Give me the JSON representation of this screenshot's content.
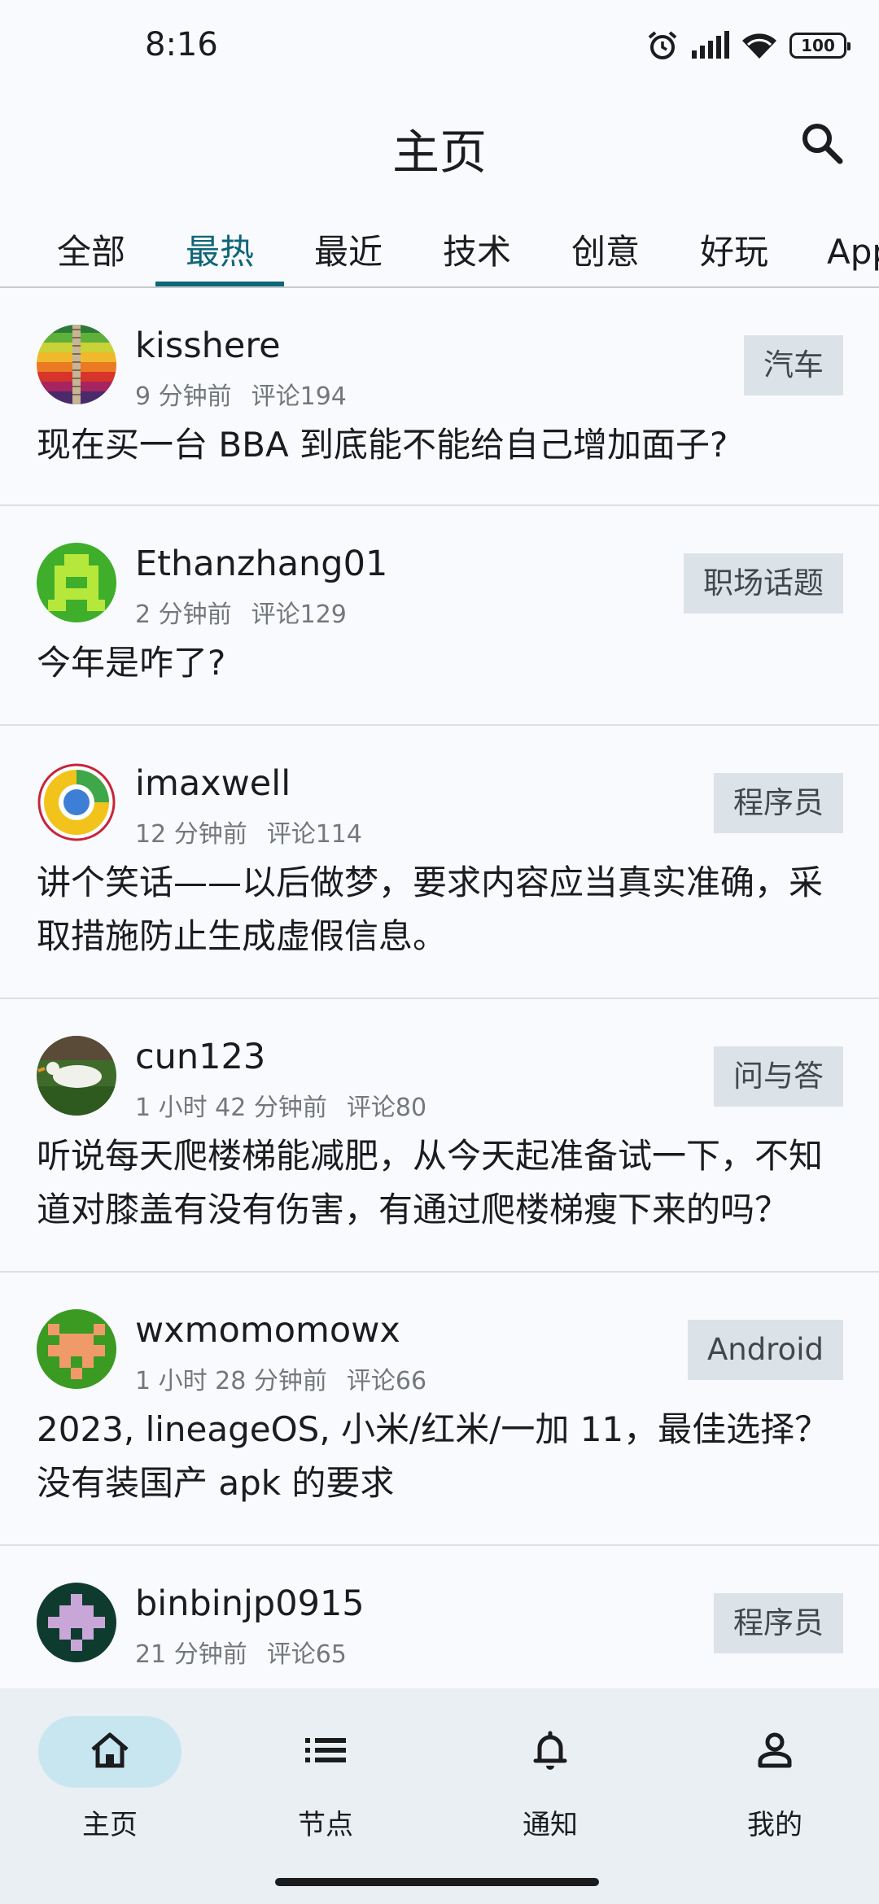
{
  "status_bar": {
    "time": "8:16",
    "battery": "100",
    "icons": [
      "alarm-icon",
      "signal-icon",
      "wifi-icon",
      "battery-icon"
    ]
  },
  "app_bar": {
    "title": "主页",
    "search_icon": "search-icon"
  },
  "tabs": [
    {
      "label": "全部",
      "active": false
    },
    {
      "label": "最热",
      "active": true
    },
    {
      "label": "最近",
      "active": false
    },
    {
      "label": "技术",
      "active": false
    },
    {
      "label": "创意",
      "active": false
    },
    {
      "label": "好玩",
      "active": false
    },
    {
      "label": "Apple",
      "active": false
    }
  ],
  "posts": [
    {
      "username": "kisshere",
      "time": "9 分钟前",
      "comments": "评论194",
      "node": "汽车",
      "title": "现在买一台 BBA 到底能不能给自己增加面子?"
    },
    {
      "username": "Ethanzhang01",
      "time": "2 分钟前",
      "comments": "评论129",
      "node": "职场话题",
      "title": "今年是咋了?"
    },
    {
      "username": "imaxwell",
      "time": "12 分钟前",
      "comments": "评论114",
      "node": "程序员",
      "title": "讲个笑话——以后做梦，要求内容应当真实准确，采取措施防止生成虚假信息。"
    },
    {
      "username": "cun123",
      "time": "1 小时 42 分钟前",
      "comments": "评论80",
      "node": "问与答",
      "title": "听说每天爬楼梯能减肥，从今天起准备试一下，不知道对膝盖有没有伤害，有通过爬楼梯瘦下来的吗？"
    },
    {
      "username": "wxmomomowx",
      "time": "1 小时 28 分钟前",
      "comments": "评论66",
      "node": "Android",
      "title": "2023, lineageOS, 小米/红米/一加 11，最佳选择？没有装国产 apk 的要求"
    },
    {
      "username": "binbinjp0915",
      "time": "21 分钟前",
      "comments": "评论65",
      "node": "程序员",
      "title": ""
    }
  ],
  "bottom_nav": [
    {
      "label": "主页",
      "icon": "home-icon",
      "active": true
    },
    {
      "label": "节点",
      "icon": "list-icon",
      "active": false
    },
    {
      "label": "通知",
      "icon": "bell-icon",
      "active": false
    },
    {
      "label": "我的",
      "icon": "person-icon",
      "active": false
    }
  ],
  "colors": {
    "accent": "#0f6678",
    "background": "#f8fafd",
    "tag_background": "#dce3e8",
    "nav_background": "#e9eff2",
    "nav_active_pill": "#c8e6f0"
  }
}
